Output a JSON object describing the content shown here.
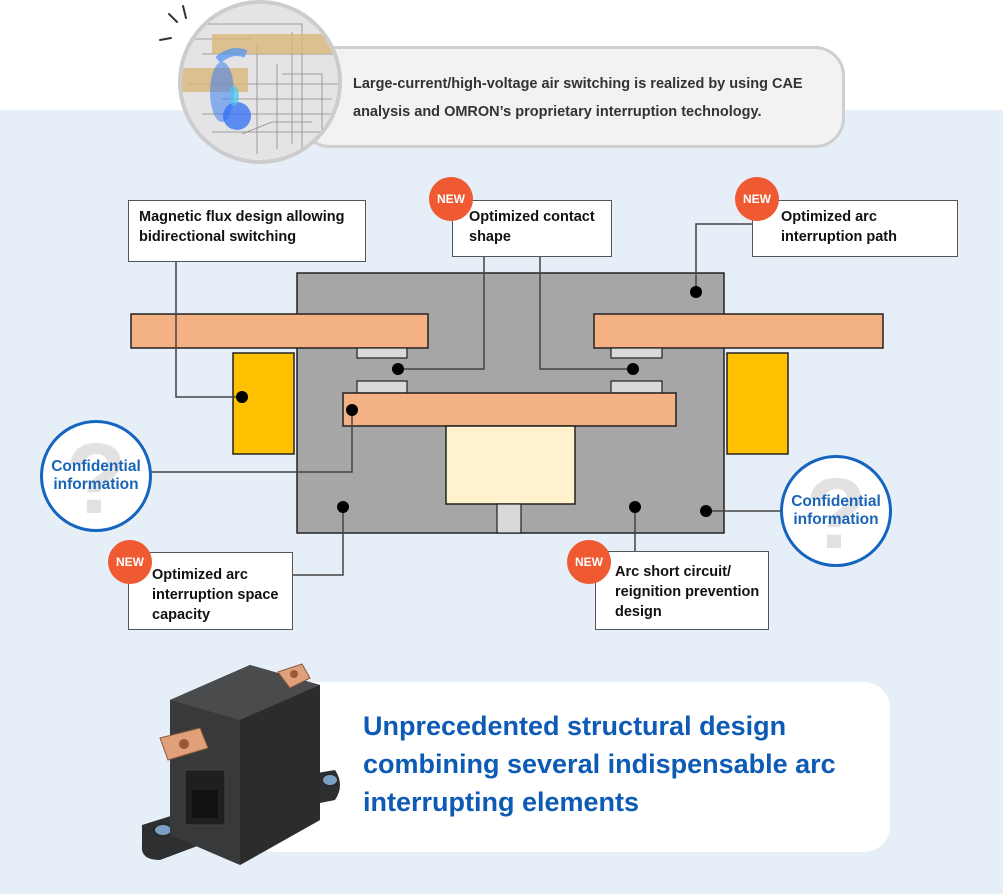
{
  "header": {
    "description": "Large-current/high-voltage air switching is realized by using CAE analysis and OMRON’s proprietary interruption technology.",
    "image": "cae-analysis-simulation"
  },
  "callouts": {
    "magnetic_flux": {
      "text": "Magnetic flux design allowing bidirectional switching",
      "is_new": false
    },
    "contact_shape": {
      "text": "Optimized contact shape",
      "is_new": true
    },
    "arc_path": {
      "text": "Optimized arc interruption path",
      "is_new": true
    },
    "arc_space": {
      "text": "Optimized arc interruption space capacity",
      "is_new": true
    },
    "arc_short": {
      "text": "Arc short circuit/ reignition prevention design",
      "is_new": true
    }
  },
  "badges": {
    "new_label": "NEW"
  },
  "confidential": {
    "label_line1": "Confidential",
    "label_line2": "information",
    "icon": "question-mark-icon"
  },
  "summary": {
    "text": "Unprecedented structural design combining several indispensable arc interrupting elements",
    "image": "relay-product-photo"
  },
  "colors": {
    "background": "#e6eef7",
    "housing": "#a6a6a6",
    "terminal": "#f4b183",
    "coil_magnet": "#ffc000",
    "actuator": "#fff2cc",
    "contact": "#d9d9d9",
    "new_badge": "#ef5a33",
    "accent_blue": "#1565c0"
  }
}
